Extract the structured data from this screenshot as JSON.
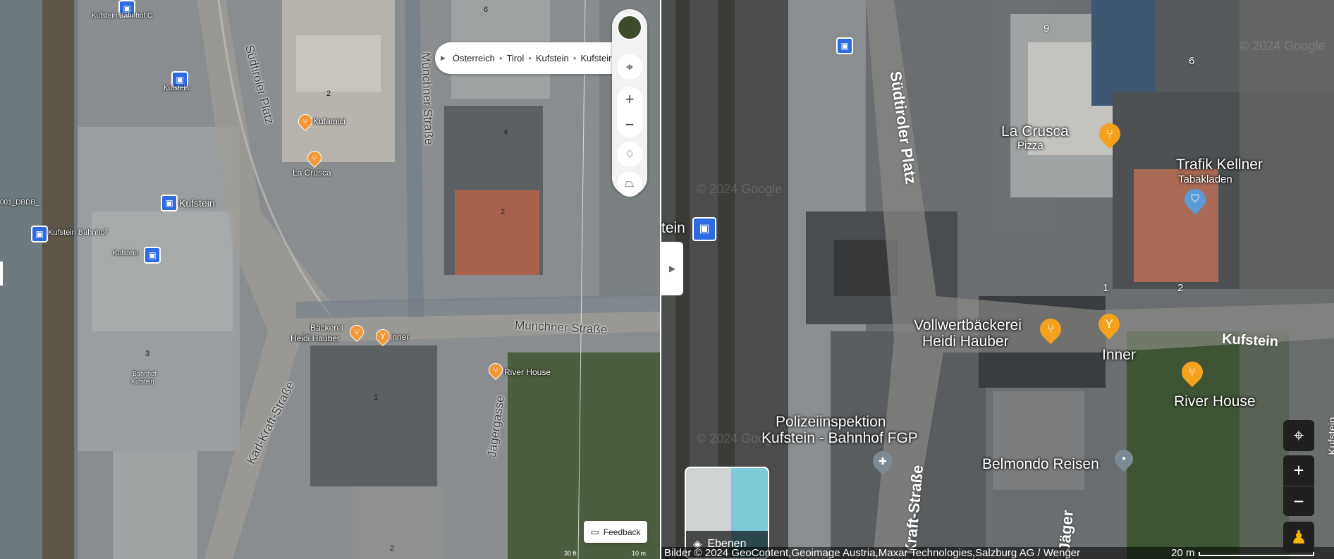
{
  "breadcrumb": {
    "items": [
      "Österreich",
      "Tirol",
      "Kufstein",
      "Kufstein"
    ]
  },
  "left_map": {
    "roads": [
      "Südtiroler Platz",
      "Münchner Straße",
      "Münchner Straße",
      "Karl-Kraft-Straße",
      "Jägergasse"
    ],
    "pois": [
      "Kufamici",
      "La Crusca",
      "Bäckerei",
      "Heidi Hauber",
      "Inner",
      "River House"
    ],
    "stations": [
      "Kufstein Bahnhof C",
      "Kufstein",
      "Kufstein",
      "Kufstein Bahnhof",
      "Kufstein",
      "Bahnhof",
      "Kufstein"
    ],
    "edge_label": "001_DBDB_",
    "house_numbers": [
      "6",
      "2",
      "4",
      "2",
      "3",
      "1",
      "2"
    ],
    "scale_left": "30 ft",
    "scale_right": "10 m",
    "feedback_label": "Feedback"
  },
  "right_map": {
    "roads": [
      "Südtiroler Platz",
      "Kraft-Straße",
      "Jäger",
      "Kufstein",
      "Kufstein"
    ],
    "pois": [
      {
        "name": "La Crusca",
        "sub": "Pizza"
      },
      {
        "name": "Trafik Kellner",
        "sub": "Tabakladen"
      },
      {
        "name": "Vollwertbäckerei",
        "sub": "Heidi Hauber"
      },
      {
        "name": "Inner",
        "sub": ""
      },
      {
        "name": "River House",
        "sub": ""
      },
      {
        "name": "Polizeiinspektion",
        "sub": "Kufstein - Bahnhof FGP"
      },
      {
        "name": "Belmondo Reisen",
        "sub": ""
      }
    ],
    "station_partial": "tein",
    "house_numbers": [
      "9",
      "6",
      "1",
      "2"
    ],
    "watermark": "© 2024 Google",
    "layers_label": "Ebenen",
    "attribution": "Bilder © 2024 GeoContent,Geoimage Austria,Maxar Technologies,Salzburg AG / Wenger",
    "scale": "20 m"
  },
  "colors": {
    "poi_orange": "#f29839",
    "poi_yellow": "#f4a21d",
    "station_blue": "#2f6be0",
    "poi_blue": "#5b9bd5",
    "poi_gray": "#7b8a93"
  }
}
